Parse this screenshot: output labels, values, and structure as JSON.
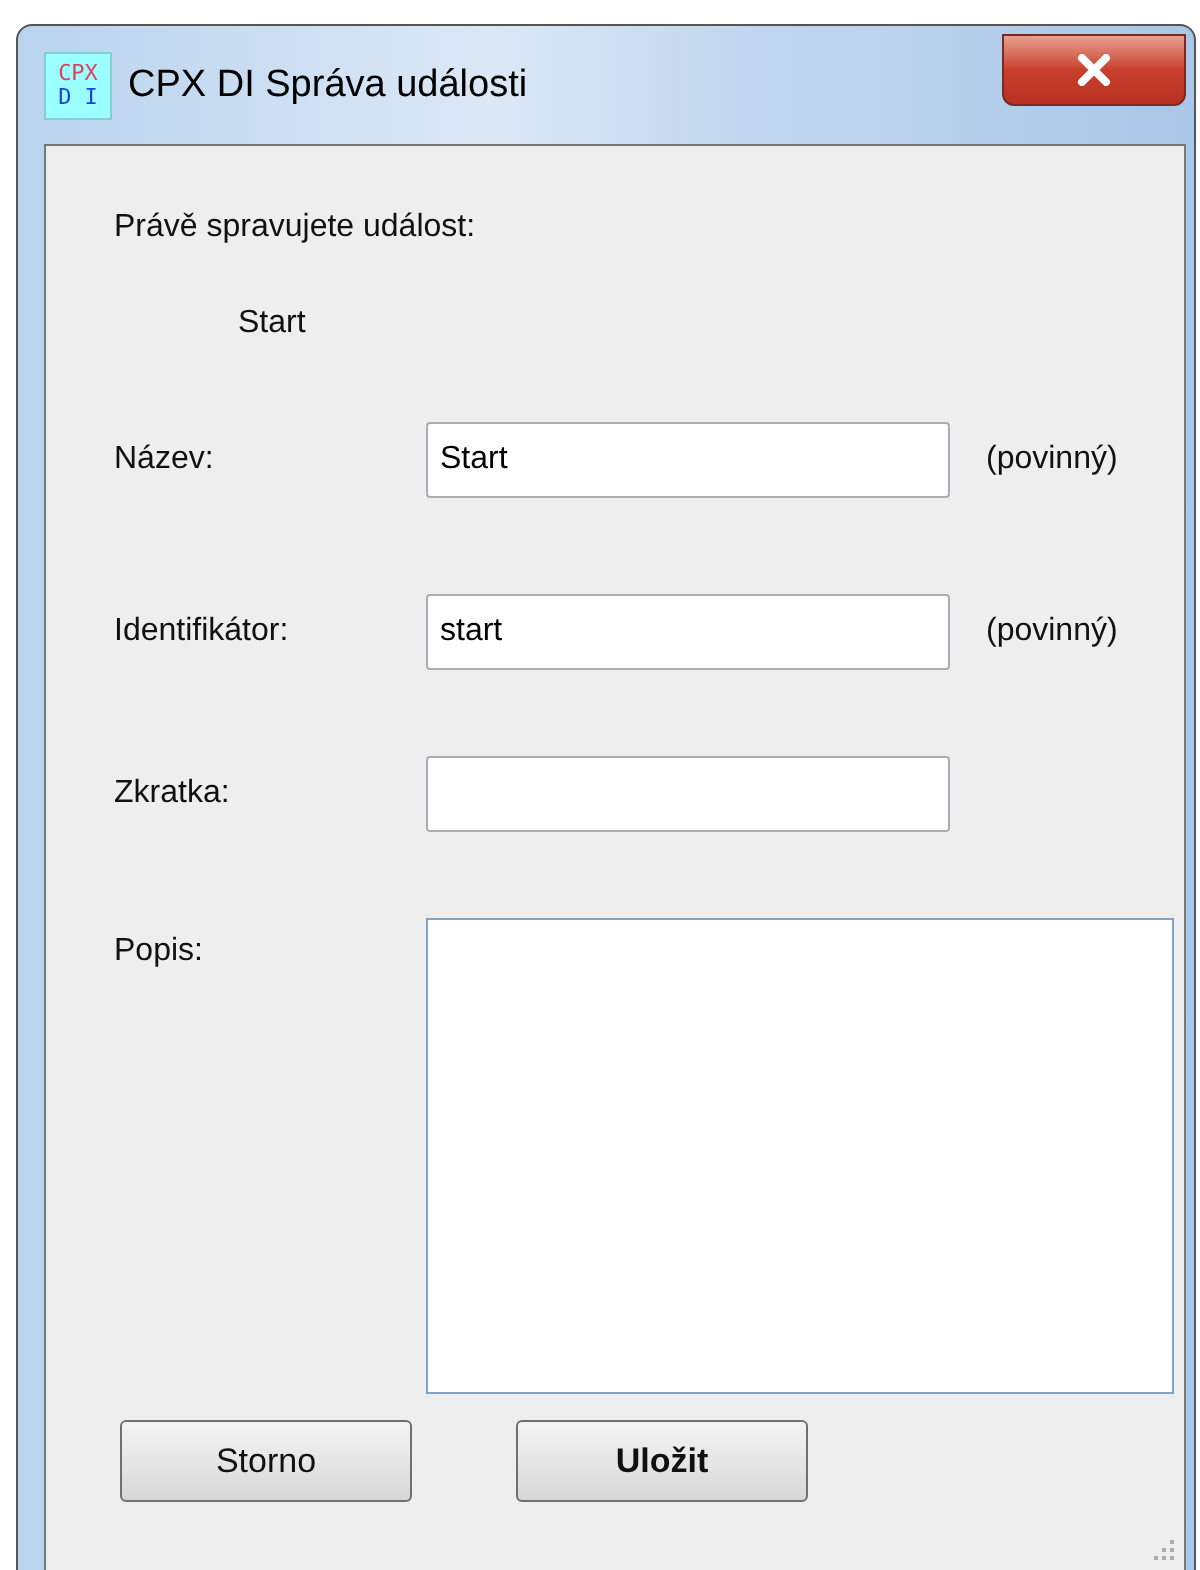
{
  "window": {
    "title": "CPX DI Správa události",
    "icon": {
      "top": "CPX",
      "bottom": "D I"
    }
  },
  "intro": "Právě spravujete událost:",
  "current_event": "Start",
  "fields": [
    {
      "label": "Název:",
      "value": "Start",
      "note": "(povinný)",
      "kind": "line"
    },
    {
      "label": "Identifikátor:",
      "value": "start",
      "note": "(povinný)",
      "kind": "line"
    },
    {
      "label": "Zkratka:",
      "kind": "line"
    },
    {
      "label": "Popis:",
      "kind": "area"
    }
  ],
  "buttons": [
    {
      "label": "Storno",
      "default": false
    },
    {
      "label": "Uložit",
      "default": true
    }
  ]
}
